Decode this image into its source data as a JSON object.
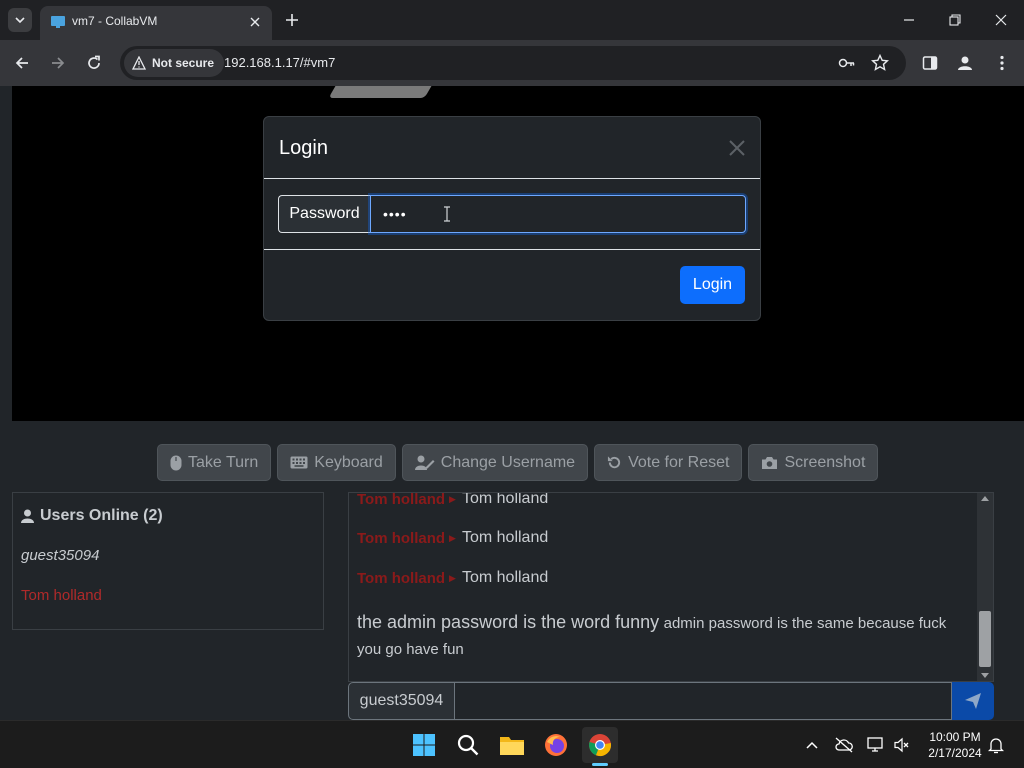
{
  "browser": {
    "tab_title": "vm7 - CollabVM",
    "security_label": "Not secure",
    "url": "192.168.1.17/#vm7"
  },
  "vm": {
    "buttons": [
      {
        "label": "Take Turn",
        "icon": "mouse-icon"
      },
      {
        "label": "Keyboard",
        "icon": "keyboard-icon"
      },
      {
        "label": "Change Username",
        "icon": "user-pen-icon"
      },
      {
        "label": "Vote for Reset",
        "icon": "rotate-icon"
      },
      {
        "label": "Screenshot",
        "icon": "camera-icon"
      }
    ]
  },
  "modal": {
    "title": "Login",
    "input_label": "Password",
    "password_mask": "••••",
    "submit_label": "Login"
  },
  "users": {
    "title": "Users Online (2)",
    "list": [
      "guest35094",
      "Tom holland"
    ]
  },
  "chat": {
    "messages": [
      {
        "user": "Tom holland",
        "text": "Tom holland"
      },
      {
        "user": "Tom holland",
        "text": "Tom holland"
      },
      {
        "user": "Tom holland",
        "text": "Tom holland"
      }
    ],
    "last_message_large": "the admin password is the word funny",
    "last_message_small": "admin password is the same because fuck you go have fun",
    "username": "guest35094"
  },
  "taskbar": {
    "time": "10:00 PM",
    "date": "2/17/2024"
  },
  "colors": {
    "accent": "#0d6efd",
    "admin_user": "#b02a2a",
    "page_bg": "#212529"
  }
}
